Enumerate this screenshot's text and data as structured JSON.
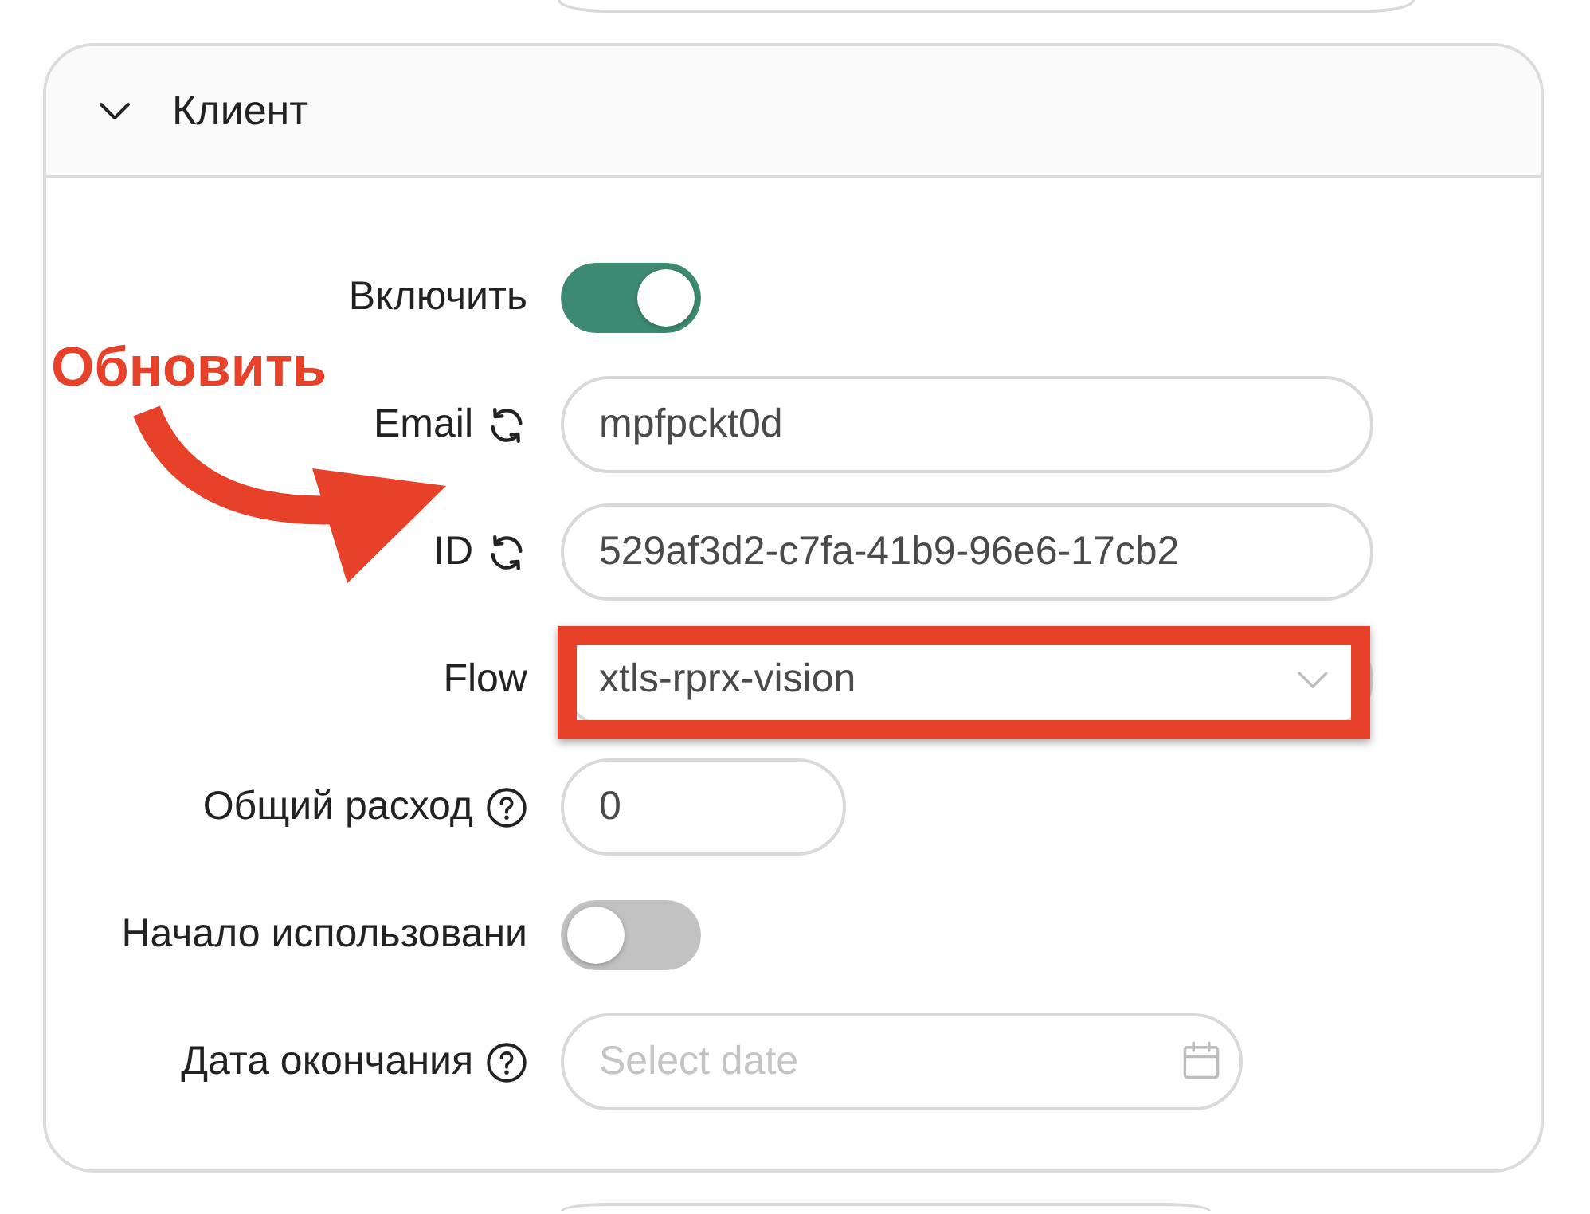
{
  "panel": {
    "title": "Клиент",
    "expanded": true
  },
  "annotation": {
    "text": "Обновить"
  },
  "fields": [
    {
      "kind": "switch",
      "label": "Включить",
      "on": true
    },
    {
      "kind": "text",
      "label": "Email",
      "refresh": true,
      "value": "mpfpckt0d"
    },
    {
      "kind": "text",
      "label": "ID",
      "refresh": true,
      "value": "529af3d2-c7fa-41b9-96e6-17cb2"
    },
    {
      "kind": "select",
      "label": "Flow",
      "value": "xtls-rprx-vision",
      "highlighted": true
    },
    {
      "kind": "number",
      "label": "Общий расход",
      "help": true,
      "value": "0"
    },
    {
      "kind": "switch",
      "label": "Начало использовани",
      "on": false
    },
    {
      "kind": "date",
      "label": "Дата окончания",
      "help": true,
      "placeholder": "Select date"
    }
  ]
}
